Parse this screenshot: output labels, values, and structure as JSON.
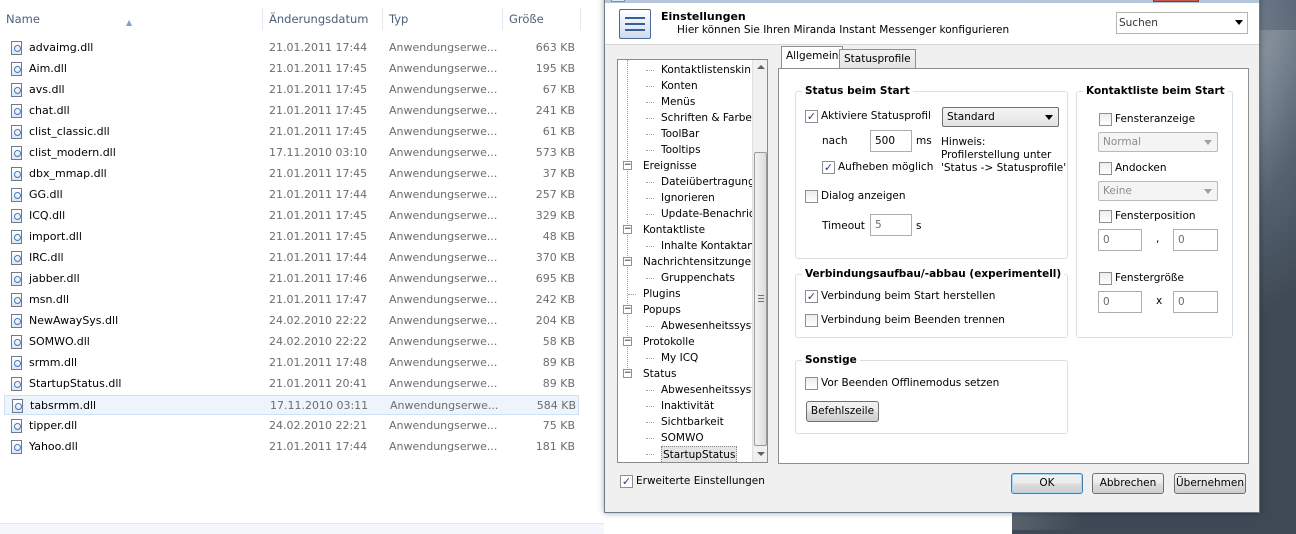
{
  "explorer": {
    "columns": {
      "name": "Name",
      "date": "Änderungsdatum",
      "type": "Typ",
      "size": "Größe"
    },
    "files": [
      {
        "name": "advaimg.dll",
        "date": "21.01.2011 17:44",
        "type": "Anwendungserwe...",
        "size": "663 KB"
      },
      {
        "name": "Aim.dll",
        "date": "21.01.2011 17:45",
        "type": "Anwendungserwe...",
        "size": "195 KB"
      },
      {
        "name": "avs.dll",
        "date": "21.01.2011 17:45",
        "type": "Anwendungserwe...",
        "size": "67 KB"
      },
      {
        "name": "chat.dll",
        "date": "21.01.2011 17:45",
        "type": "Anwendungserwe...",
        "size": "241 KB"
      },
      {
        "name": "clist_classic.dll",
        "date": "21.01.2011 17:45",
        "type": "Anwendungserwe...",
        "size": "61 KB"
      },
      {
        "name": "clist_modern.dll",
        "date": "17.11.2010 03:10",
        "type": "Anwendungserwe...",
        "size": "573 KB"
      },
      {
        "name": "dbx_mmap.dll",
        "date": "21.01.2011 17:45",
        "type": "Anwendungserwe...",
        "size": "37 KB"
      },
      {
        "name": "GG.dll",
        "date": "21.01.2011 17:44",
        "type": "Anwendungserwe...",
        "size": "257 KB"
      },
      {
        "name": "ICQ.dll",
        "date": "21.01.2011 17:45",
        "type": "Anwendungserwe...",
        "size": "329 KB"
      },
      {
        "name": "import.dll",
        "date": "21.01.2011 17:45",
        "type": "Anwendungserwe...",
        "size": "48 KB"
      },
      {
        "name": "IRC.dll",
        "date": "21.01.2011 17:44",
        "type": "Anwendungserwe...",
        "size": "370 KB"
      },
      {
        "name": "jabber.dll",
        "date": "21.01.2011 17:46",
        "type": "Anwendungserwe...",
        "size": "695 KB"
      },
      {
        "name": "msn.dll",
        "date": "21.01.2011 17:47",
        "type": "Anwendungserwe...",
        "size": "242 KB"
      },
      {
        "name": "NewAwaySys.dll",
        "date": "24.02.2010 22:22",
        "type": "Anwendungserwe...",
        "size": "204 KB"
      },
      {
        "name": "SOMWO.dll",
        "date": "24.02.2010 22:22",
        "type": "Anwendungserwe...",
        "size": "58 KB"
      },
      {
        "name": "srmm.dll",
        "date": "21.01.2011 17:48",
        "type": "Anwendungserwe...",
        "size": "89 KB"
      },
      {
        "name": "StartupStatus.dll",
        "date": "21.01.2011 20:41",
        "type": "Anwendungserwe...",
        "size": "89 KB"
      },
      {
        "name": "tabsrmm.dll",
        "date": "17.11.2010 03:11",
        "type": "Anwendungserwe...",
        "size": "584 KB",
        "selected": true
      },
      {
        "name": "tipper.dll",
        "date": "24.02.2010 22:21",
        "type": "Anwendungserwe...",
        "size": "75 KB"
      },
      {
        "name": "Yahoo.dll",
        "date": "21.01.2011 17:44",
        "type": "Anwendungserwe...",
        "size": "181 KB"
      }
    ]
  },
  "settings": {
    "title": "Einstellungen",
    "subtitle": "Hier können Sie Ihren Miranda Instant Messenger konfigurieren",
    "search_value": "Suchen",
    "tree": [
      {
        "label": "Kontaktlistenskin",
        "level": 1
      },
      {
        "label": "Konten",
        "level": 1
      },
      {
        "label": "Menüs",
        "level": 1
      },
      {
        "label": "Schriften & Farben",
        "level": 1
      },
      {
        "label": "ToolBar",
        "level": 1
      },
      {
        "label": "Tooltips",
        "level": 1
      },
      {
        "label": "Ereignisse",
        "level": 0,
        "expander": "−"
      },
      {
        "label": "Dateiübertragungen",
        "level": 1
      },
      {
        "label": "Ignorieren",
        "level": 1
      },
      {
        "label": "Update-Benachrichtigung",
        "level": 1
      },
      {
        "label": "Kontaktliste",
        "level": 0,
        "expander": "−"
      },
      {
        "label": "Inhalte Kontaktanzeige",
        "level": 1
      },
      {
        "label": "Nachrichtensitzungen",
        "level": 0,
        "expander": "−"
      },
      {
        "label": "Gruppenchats",
        "level": 1
      },
      {
        "label": "Plugins",
        "level": 0
      },
      {
        "label": "Popups",
        "level": 0,
        "expander": "−"
      },
      {
        "label": "Abwesenheitssystem",
        "level": 1
      },
      {
        "label": "Protokolle",
        "level": 0,
        "expander": "−"
      },
      {
        "label": "My ICQ",
        "level": 1
      },
      {
        "label": "Status",
        "level": 0,
        "expander": "−"
      },
      {
        "label": "Abwesenheitssystem",
        "level": 1
      },
      {
        "label": "Inaktivität",
        "level": 1
      },
      {
        "label": "Sichtbarkeit",
        "level": 1
      },
      {
        "label": "SOMWO",
        "level": 1
      },
      {
        "label": "StartupStatus",
        "level": 1,
        "selected": true
      }
    ],
    "tabs": [
      "Allgemein",
      "Statusprofile"
    ],
    "status_group": {
      "title": "Status beim Start",
      "activate_profile": "Aktiviere Statusprofil",
      "profile_value": "Standard",
      "after_label": "nach",
      "after_value": "500",
      "ms_label": "ms",
      "hint": "Hinweis:\nProfilerstellung unter\n'Status -> Statusprofile'",
      "override": "Aufheben möglich",
      "dialog": "Dialog anzeigen",
      "timeout_label": "Timeout",
      "timeout_value": "5",
      "s_label": "s"
    },
    "connection_group": {
      "title": "Verbindungsaufbau/-abbau (experimentell)",
      "connect_on_start": "Verbindung beim Start herstellen",
      "disconnect_on_exit": "Verbindung beim Beenden trennen"
    },
    "misc_group": {
      "title": "Sonstige",
      "offline_on_exit": "Vor Beenden Offlinemodus setzen",
      "cmdline_button": "Befehlszeile"
    },
    "clist_group": {
      "title": "Kontaktliste beim Start",
      "window_state": "Fensteranzeige",
      "window_state_value": "Normal",
      "docked": "Andocken",
      "docked_value": "Keine",
      "position": "Fensterposition",
      "pos_x": "0",
      "pos_sep": ",",
      "pos_y": "0",
      "size": "Fenstergröße",
      "size_w": "0",
      "size_sep": "x",
      "size_h": "0"
    },
    "expert_settings": "Erweiterte Einstellungen",
    "buttons": {
      "ok": "OK",
      "cancel": "Abbrechen",
      "apply": "Übernehmen"
    }
  }
}
